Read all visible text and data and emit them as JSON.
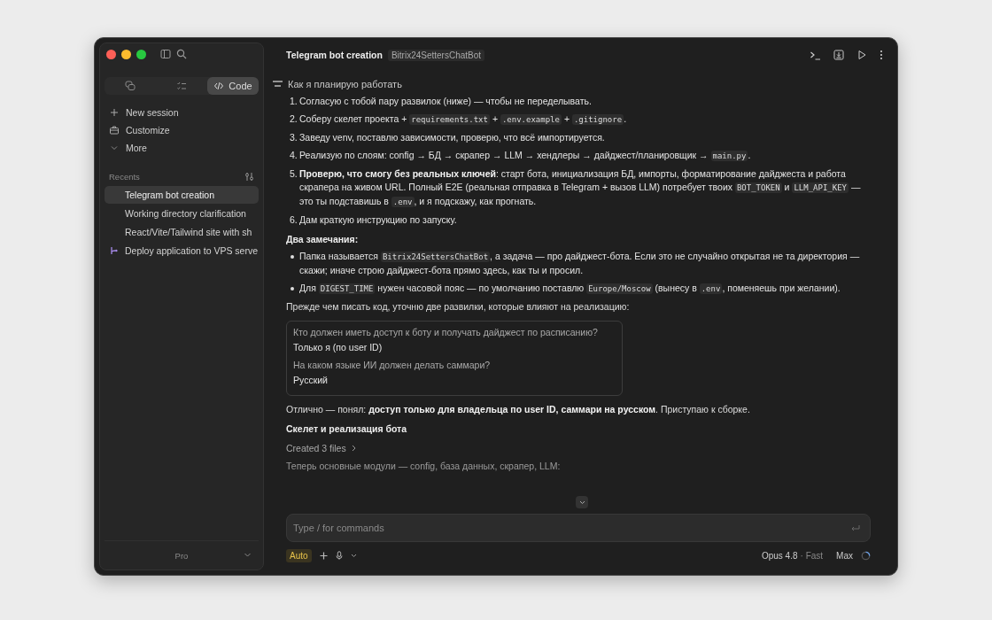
{
  "window": {
    "title": "Telegram bot creation",
    "badge": "Bitrix24SettersChatBot"
  },
  "sidebar": {
    "tabs": [
      {
        "kind": "chat",
        "selected": false
      },
      {
        "kind": "tasks",
        "selected": false
      },
      {
        "kind": "code",
        "label": "Code",
        "selected": true
      }
    ],
    "nav": [
      {
        "kind": "plus",
        "label": "New session"
      },
      {
        "kind": "case",
        "label": "Customize"
      },
      {
        "kind": "chevron",
        "label": "More"
      }
    ],
    "recents_label": "Recents",
    "recents": [
      {
        "label": "Telegram bot creation",
        "selected": true,
        "kind": "plain"
      },
      {
        "label": "Working directory clarification",
        "selected": false,
        "kind": "plain"
      },
      {
        "label": "React/Vite/Tailwind site with sh",
        "selected": false,
        "kind": "plain"
      },
      {
        "label": "Deploy application to VPS serve",
        "selected": false,
        "kind": "branch"
      }
    ],
    "plan": "Pro"
  },
  "blocks": [
    {
      "kind": "heading",
      "text": "Как я планирую работать"
    },
    {
      "kind": "ol",
      "items": [
        {
          "number": "1.",
          "segments": [
            {
              "kind": "text",
              "text": "Согласую с тобой пару развилок (ниже) — чтобы не переделывать."
            }
          ]
        },
        {
          "number": "2.",
          "segments": [
            {
              "kind": "text",
              "text": "Соберу скелет проекта + "
            },
            {
              "kind": "code",
              "text": "requirements.txt"
            },
            {
              "kind": "text",
              "text": " + "
            },
            {
              "kind": "code",
              "text": ".env.example"
            },
            {
              "kind": "text",
              "text": " + "
            },
            {
              "kind": "code",
              "text": ".gitignore"
            },
            {
              "kind": "text",
              "text": "."
            }
          ]
        },
        {
          "number": "3.",
          "segments": [
            {
              "kind": "text",
              "text": "Заведу venv, поставлю зависимости, проверю, что всё импортируется."
            }
          ]
        },
        {
          "number": "4.",
          "segments": [
            {
              "kind": "text",
              "text": "Реализую по слоям: config → БД → скрапер → LLM → хендлеры → дайджест/планировщик → "
            },
            {
              "kind": "code",
              "text": "main.py"
            },
            {
              "kind": "text",
              "text": "."
            }
          ]
        },
        {
          "number": "5.",
          "segments": [
            {
              "kind": "bold",
              "text": "Проверю, что смогу без реальных ключей"
            },
            {
              "kind": "text",
              "text": ": старт бота, инициализация БД, импорты, форматирование дайджеста и работа скрапера на живом URL. Полный E2E (реальная отправка в Telegram + вызов LLM) потребует твоих "
            },
            {
              "kind": "code",
              "text": "BOT_TOKEN"
            },
            {
              "kind": "text",
              "text": " и "
            },
            {
              "kind": "code",
              "text": "LLM_API_KEY"
            },
            {
              "kind": "text",
              "text": " — это ты подставишь в "
            },
            {
              "kind": "code",
              "text": ".env"
            },
            {
              "kind": "text",
              "text": ", и я подскажу, как прогнать."
            }
          ]
        },
        {
          "number": "6.",
          "segments": [
            {
              "kind": "text",
              "text": "Дам краткую инструкцию по запуску."
            }
          ]
        }
      ]
    },
    {
      "kind": "subheading",
      "text": "Два замечания:"
    },
    {
      "kind": "ul",
      "items": [
        [
          {
            "kind": "text",
            "text": "Папка называется "
          },
          {
            "kind": "code",
            "text": "Bitrix24SettersChatBot"
          },
          {
            "kind": "text",
            "text": ", а задача — про дайджест-бота. Если это не случайно открытая не та директория — скажи; иначе строю дайджест-бота прямо здесь, как ты и просил."
          }
        ],
        [
          {
            "kind": "text",
            "text": "Для "
          },
          {
            "kind": "code",
            "text": "DIGEST_TIME"
          },
          {
            "kind": "text",
            "text": " нужен часовой пояс — по умолчанию поставлю "
          },
          {
            "kind": "code",
            "text": "Europe/Moscow"
          },
          {
            "kind": "text",
            "text": " (вынесу в "
          },
          {
            "kind": "code",
            "text": ".env"
          },
          {
            "kind": "text",
            "text": ", поменяешь при желании)."
          }
        ]
      ]
    },
    {
      "kind": "para",
      "segments": [
        {
          "kind": "text",
          "text": "Прежде чем писать код, уточню две развилки, которые влияют на реализацию:"
        }
      ]
    },
    {
      "kind": "qa",
      "pairs": [
        {
          "question": "Кто должен иметь доступ к боту и получать дайджест по расписанию?",
          "answer": "Только я (по user ID)"
        },
        {
          "question": "На каком языке ИИ должен делать саммари?",
          "answer": "Русский"
        }
      ]
    },
    {
      "kind": "para",
      "segments": [
        {
          "kind": "text",
          "text": "Отлично — понял: "
        },
        {
          "kind": "bold",
          "text": "доступ только для владельца по user ID, саммари на русском"
        },
        {
          "kind": "text",
          "text": ". Приступаю к сборке."
        }
      ]
    },
    {
      "kind": "subheading",
      "text": "Скелет и реализация бота"
    },
    {
      "kind": "files",
      "text": "Created 3 files"
    },
    {
      "kind": "muted",
      "text": "Теперь основные модули — config, база данных, скрапер, LLM:"
    }
  ],
  "composer": {
    "placeholder": "Type / for commands",
    "mode": "Auto",
    "model": "Opus 4.8",
    "speed": "· Fast",
    "effort": "Max"
  }
}
